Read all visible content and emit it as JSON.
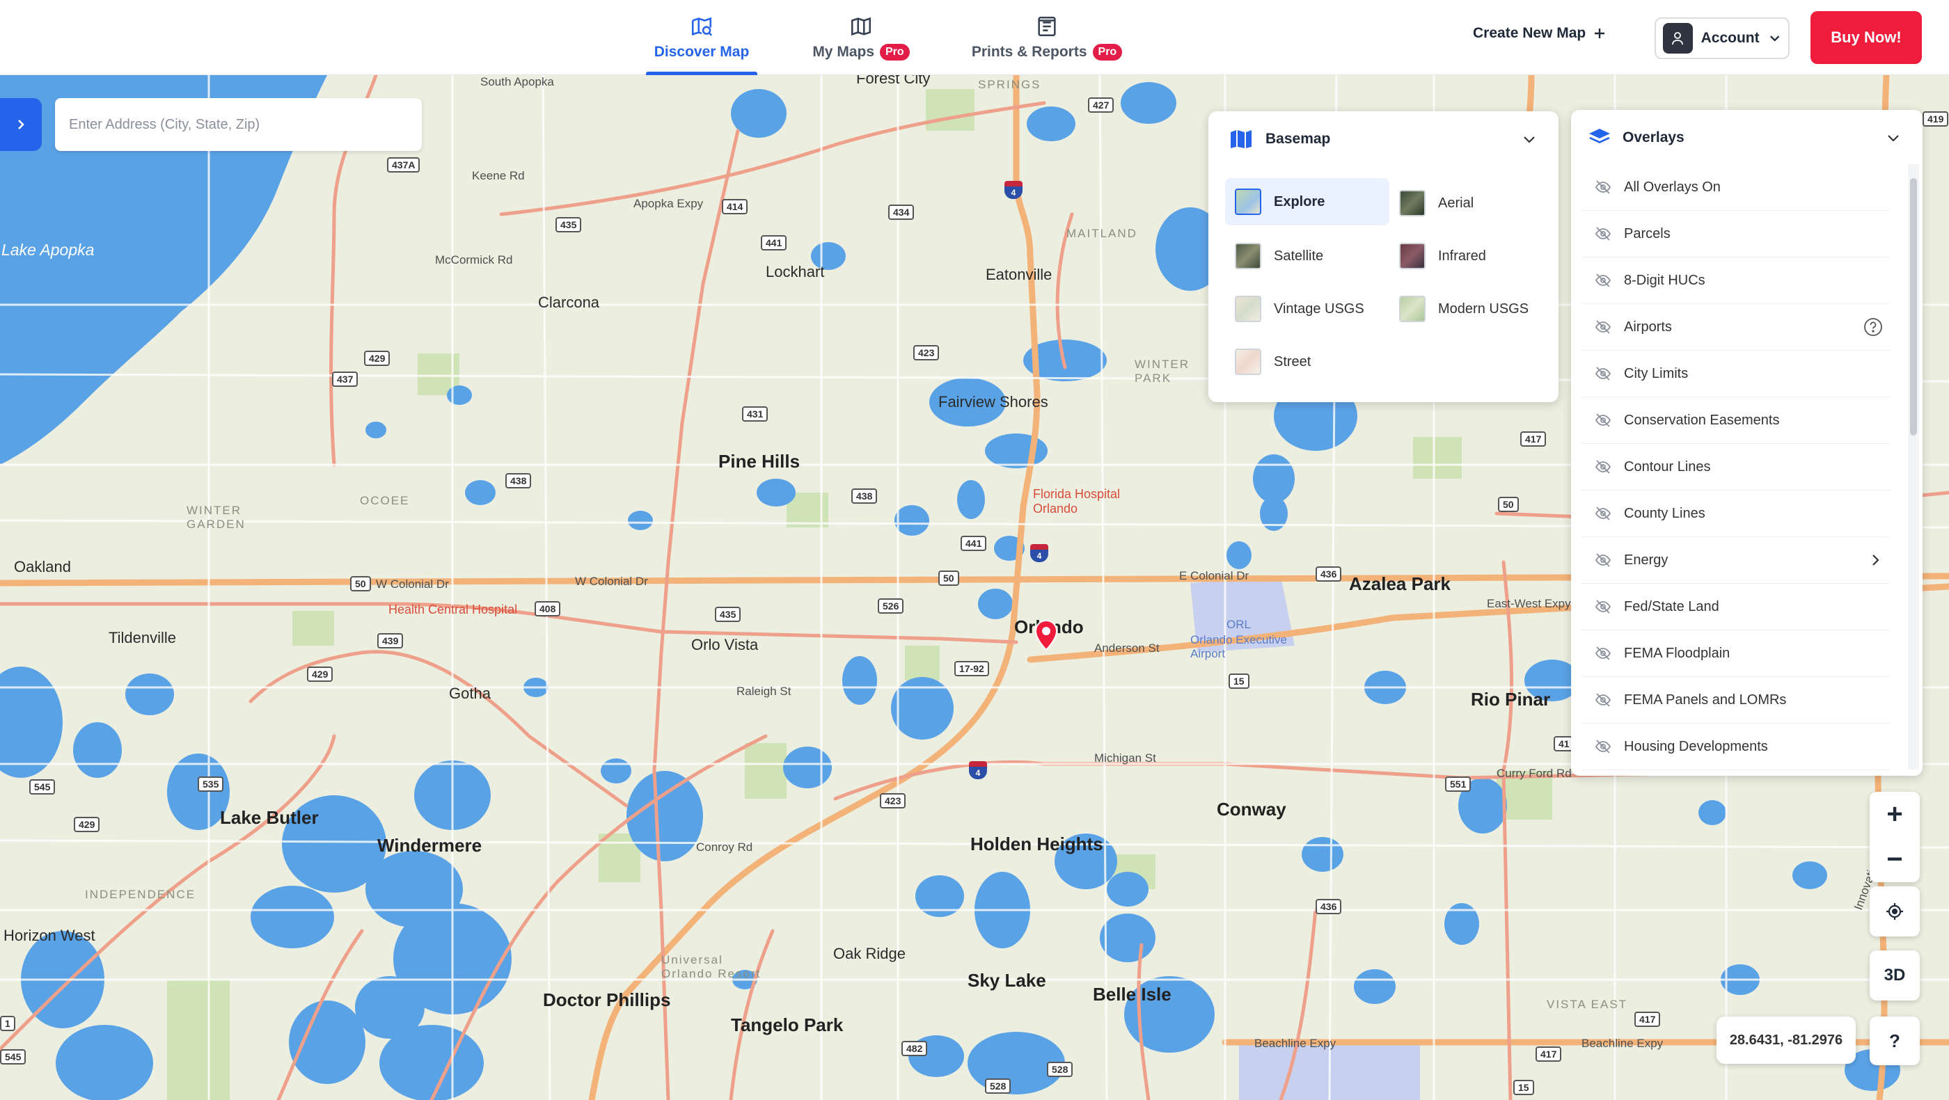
{
  "nav": {
    "tabs": [
      {
        "label": "Discover Map",
        "icon": "map-search-icon",
        "active": true
      },
      {
        "label": "My Maps",
        "icon": "folded-map-icon",
        "badge": "Pro"
      },
      {
        "label": "Prints & Reports",
        "icon": "report-icon",
        "badge": "Pro"
      }
    ],
    "create_map": "Create New Map",
    "account": "Account",
    "buy": "Buy Now!"
  },
  "search": {
    "placeholder": "Enter Address (City, State, Zip)",
    "value": ""
  },
  "basemap": {
    "title": "Basemap",
    "options": [
      {
        "label": "Explore",
        "selected": true
      },
      {
        "label": "Aerial"
      },
      {
        "label": "Satellite"
      },
      {
        "label": "Infrared"
      },
      {
        "label": "Vintage USGS"
      },
      {
        "label": "Modern USGS"
      },
      {
        "label": "Street"
      }
    ]
  },
  "overlays": {
    "title": "Overlays",
    "items": [
      {
        "label": "All Overlays On"
      },
      {
        "label": "Parcels"
      },
      {
        "label": "8-Digit HUCs"
      },
      {
        "label": "Airports",
        "extra": "help"
      },
      {
        "label": "City Limits"
      },
      {
        "label": "Conservation Easements"
      },
      {
        "label": "Contour Lines"
      },
      {
        "label": "County Lines"
      },
      {
        "label": "Energy",
        "extra": "submenu"
      },
      {
        "label": "Fed/State Land"
      },
      {
        "label": "FEMA Floodplain"
      },
      {
        "label": "FEMA Panels and LOMRs"
      },
      {
        "label": "Housing Developments"
      }
    ]
  },
  "controls": {
    "zoom_in": "+",
    "zoom_out": "−",
    "three_d": "3D",
    "help": "?"
  },
  "coordinates": "28.6431, -81.2976",
  "map_labels": {
    "lake_apopka": "Lake Apopka",
    "south_apopka": "South Apopka",
    "forest_city": "Forest City",
    "springs": "SPRINGS",
    "keene_rd": "Keene Rd",
    "apopka_expy": "Apopka Expy",
    "maitland": "MAITLAND",
    "eatonville": "Eatonville",
    "lockhart": "Lockhart",
    "mccormick_rd": "McCormick Rd",
    "clarcona": "Clarcona",
    "winter_park": "WINTER\nPARK",
    "fairview_shores": "Fairview Shores",
    "pine_hills": "Pine Hills",
    "winter_garden": "WINTER\nGARDEN",
    "ocoee": "OCOEE",
    "florida_hospital": "Florida Hospital\nOrlando",
    "oakland": "Oakland",
    "w_colonial_dr_1": "W Colonial Dr",
    "w_colonial_dr_2": "W Colonial Dr",
    "e_colonial_dr": "E Colonial Dr",
    "azalea_park": "Azalea Park",
    "east_west_expy": "East-West Expy",
    "health_central": "Health Central Hospital",
    "tildenville": "Tildenville",
    "orlo_vista": "Orlo Vista",
    "orlando": "Orlando",
    "anderson_st": "Anderson St",
    "orl": "ORL",
    "orlando_exec": "Orlando Executive\nAirport",
    "gotha": "Gotha",
    "raleigh_st": "Raleigh St",
    "rio_pinar": "Rio Pinar",
    "michigan_st": "Michigan St",
    "curry_ford_rd": "Curry Ford Rd",
    "lake_butler": "Lake Butler",
    "windermere": "Windermere",
    "conroy_rd": "Conroy Rd",
    "holden_heights": "Holden Heights",
    "conway": "Conway",
    "independence": "INDEPENDENCE",
    "horizon_west": "Horizon West",
    "oak_ridge": "Oak Ridge",
    "universal": "Universal\nOrlando Resort",
    "sky_lake": "Sky Lake",
    "belle_isle": "Belle Isle",
    "doctor_phillips": "Doctor Phillips",
    "tangelo_park": "Tangelo Park",
    "vista_east": "VISTA EAST",
    "beachline_1": "Beachline Expy",
    "beachline_2": "Beachline Expy",
    "innovation_way": "Innovation Wa"
  },
  "shields": [
    "437A",
    "414",
    "435",
    "441",
    "434",
    "427",
    "429",
    "437",
    "423",
    "431",
    "438",
    "438",
    "441",
    "50",
    "50",
    "408",
    "439",
    "435",
    "526",
    "17-92",
    "15",
    "429",
    "545",
    "535",
    "429",
    "423",
    "436",
    "551",
    "436",
    "482",
    "528",
    "528",
    "417",
    "545",
    "417",
    "50",
    "417",
    "419",
    "41",
    "15",
    "1",
    "50"
  ],
  "pin_color": "#ef1c3b",
  "accent_color": "#2563eb"
}
